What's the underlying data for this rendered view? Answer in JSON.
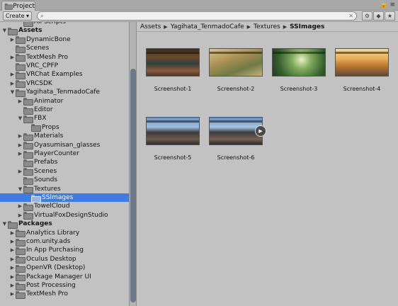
{
  "tab": {
    "title": "Project"
  },
  "toolbar": {
    "create_label": "Create ▾",
    "search_placeholder": ""
  },
  "tree": {
    "rows": [
      {
        "label": "All Scripts",
        "indent": 2,
        "arrow": "",
        "section": false
      },
      {
        "label": "Assets",
        "indent": 0,
        "arrow": "▼",
        "section": true
      },
      {
        "label": "DynamicBone",
        "indent": 1,
        "arrow": "▶",
        "section": false
      },
      {
        "label": "Scenes",
        "indent": 1,
        "arrow": "",
        "section": false
      },
      {
        "label": "TextMesh Pro",
        "indent": 1,
        "arrow": "▶",
        "section": false
      },
      {
        "label": "VRC_CPFP",
        "indent": 1,
        "arrow": "",
        "section": false
      },
      {
        "label": "VRChat Examples",
        "indent": 1,
        "arrow": "▶",
        "section": false
      },
      {
        "label": "VRCSDK",
        "indent": 1,
        "arrow": "▶",
        "section": false
      },
      {
        "label": "Yagihata_TenmadoCafe",
        "indent": 1,
        "arrow": "▼",
        "section": false
      },
      {
        "label": "Animator",
        "indent": 2,
        "arrow": "▶",
        "section": false
      },
      {
        "label": "Editor",
        "indent": 2,
        "arrow": "",
        "section": false
      },
      {
        "label": "FBX",
        "indent": 2,
        "arrow": "▼",
        "section": false
      },
      {
        "label": "Props",
        "indent": 3,
        "arrow": "",
        "section": false
      },
      {
        "label": "Materials",
        "indent": 2,
        "arrow": "▶",
        "section": false
      },
      {
        "label": "Oyasumisan_glasses",
        "indent": 2,
        "arrow": "▶",
        "section": false
      },
      {
        "label": "PlayerCounter",
        "indent": 2,
        "arrow": "▶",
        "section": false
      },
      {
        "label": "Prefabs",
        "indent": 2,
        "arrow": "",
        "section": false
      },
      {
        "label": "Scenes",
        "indent": 2,
        "arrow": "▶",
        "section": false
      },
      {
        "label": "Sounds",
        "indent": 2,
        "arrow": "",
        "section": false
      },
      {
        "label": "Textures",
        "indent": 2,
        "arrow": "▼",
        "section": false
      },
      {
        "label": "SSImages",
        "indent": 3,
        "arrow": "",
        "section": false,
        "selected": true
      },
      {
        "label": "TowelCloud",
        "indent": 2,
        "arrow": "▶",
        "section": false
      },
      {
        "label": "VirtualFoxDesignStudio",
        "indent": 2,
        "arrow": "▶",
        "section": false
      },
      {
        "label": "Packages",
        "indent": 0,
        "arrow": "▼",
        "section": true
      },
      {
        "label": "Analytics Library",
        "indent": 1,
        "arrow": "▶",
        "section": false
      },
      {
        "label": "com.unity.ads",
        "indent": 1,
        "arrow": "▶",
        "section": false
      },
      {
        "label": "In App Purchasing",
        "indent": 1,
        "arrow": "▶",
        "section": false
      },
      {
        "label": "Oculus Desktop",
        "indent": 1,
        "arrow": "▶",
        "section": false
      },
      {
        "label": "OpenVR (Desktop)",
        "indent": 1,
        "arrow": "▶",
        "section": false
      },
      {
        "label": "Package Manager UI",
        "indent": 1,
        "arrow": "▶",
        "section": false
      },
      {
        "label": "Post Processing",
        "indent": 1,
        "arrow": "▶",
        "section": false
      },
      {
        "label": "TextMesh Pro",
        "indent": 1,
        "arrow": "▶",
        "section": false
      }
    ]
  },
  "breadcrumb": {
    "items": [
      "Assets",
      "Yagihata_TenmadoCafe",
      "Textures",
      "SSImages"
    ]
  },
  "assets": {
    "items": [
      {
        "label": "Screenshot-1",
        "style": "t1"
      },
      {
        "label": "Screenshot-2",
        "style": "t2"
      },
      {
        "label": "Screenshot-3",
        "style": "t3"
      },
      {
        "label": "Screenshot-4",
        "style": "t4"
      },
      {
        "label": "Screenshot-5",
        "style": "t5"
      },
      {
        "label": "Screenshot-6",
        "style": "t6",
        "has_play": true
      }
    ]
  },
  "colors": {
    "selection": "#3e7ce4",
    "panel": "#c2c2c2"
  }
}
